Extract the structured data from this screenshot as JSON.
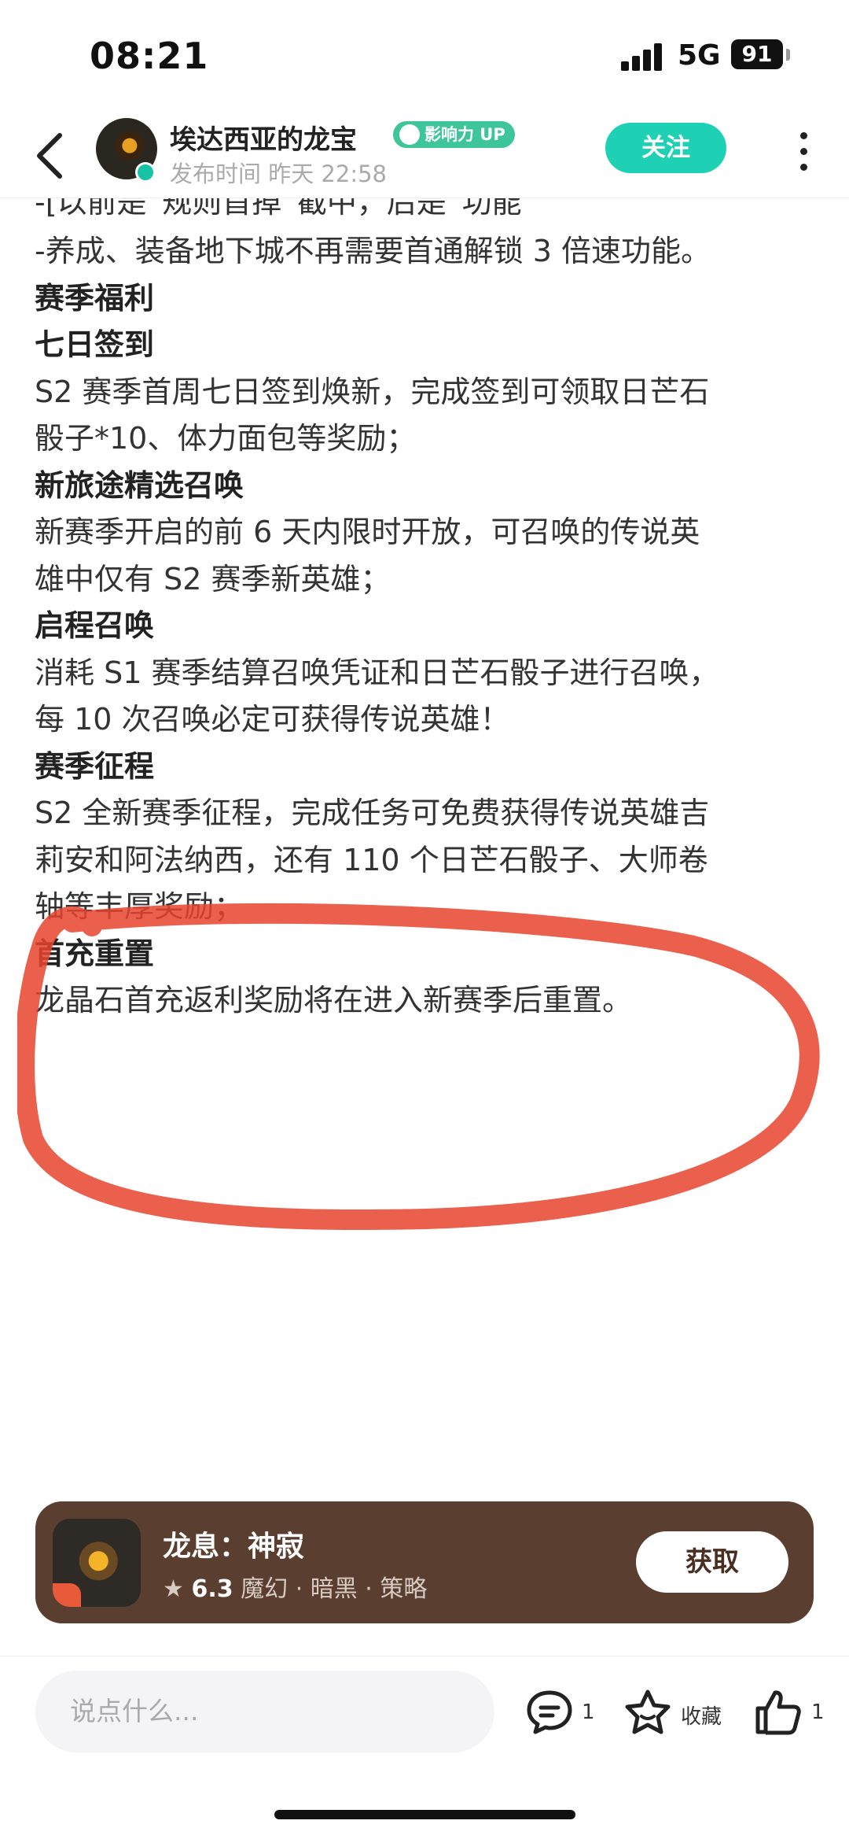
{
  "status_bar": {
    "time": "08:21",
    "network": "5G",
    "battery": "91"
  },
  "header": {
    "author_name": "埃达西亚的龙宝",
    "badge_label": "影响力 UP",
    "publish_time": "发布时间 昨天 22:58",
    "follow_label": "关注"
  },
  "article": {
    "cut_line": "-[以前是“规则首掉”截中，后是“功能”",
    "blocks": [
      {
        "type": "p",
        "text": "-养成、装备地下城不再需要首通解锁 3 倍速功能。"
      },
      {
        "type": "h",
        "text": "赛季福利"
      },
      {
        "type": "h",
        "text": "七日签到"
      },
      {
        "type": "p",
        "text": "S2 赛季首周七日签到焕新，完成签到可领取日芒石"
      },
      {
        "type": "p",
        "text": "骰子*10、体力面包等奖励；"
      },
      {
        "type": "h",
        "text": "新旅途精选召唤"
      },
      {
        "type": "p",
        "text": "新赛季开启的前 6 天内限时开放，可召唤的传说英"
      },
      {
        "type": "p",
        "text": "雄中仅有 S2 赛季新英雄；"
      },
      {
        "type": "h",
        "text": "启程召唤"
      },
      {
        "type": "p",
        "text": "消耗 S1 赛季结算召唤凭证和日芒石骰子进行召唤，"
      },
      {
        "type": "p",
        "text": "每 10 次召唤必定可获得传说英雄！"
      },
      {
        "type": "h",
        "text": "赛季征程"
      },
      {
        "type": "p",
        "text": "S2 全新赛季征程，完成任务可免费获得传说英雄吉"
      },
      {
        "type": "p",
        "text": "莉安和阿法纳西，还有 110 个日芒石骰子、大师卷"
      },
      {
        "type": "p",
        "text": "轴等丰厚奖励；"
      },
      {
        "type": "h",
        "text": "首充重置"
      },
      {
        "type": "p",
        "text": "龙晶石首充返利奖励将在进入新赛季后重置。"
      }
    ]
  },
  "game_card": {
    "title": "龙息：神寂",
    "rating": "6.3",
    "tags": "魔幻 · 暗黑 · 策略",
    "get_label": "获取"
  },
  "bottom_bar": {
    "comment_placeholder": "说点什么...",
    "comment_count": "1",
    "favorite_label": "收藏",
    "like_count": "1"
  },
  "colors": {
    "accent": "#1ed1b4",
    "badge": "#3ec69a",
    "card": "#5a3e30",
    "annotation": "#e8442e"
  },
  "icons": [
    "back-icon",
    "verified-icon",
    "more-icon",
    "star-icon",
    "comment-icon",
    "favorite-icon",
    "like-icon"
  ]
}
